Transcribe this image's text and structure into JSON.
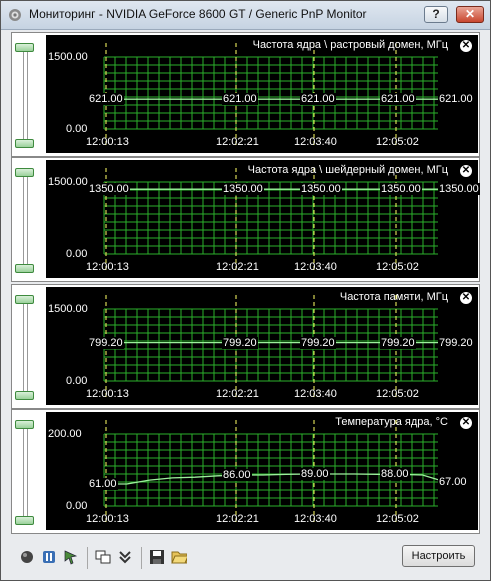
{
  "window": {
    "title": "Мониторинг - NVIDIA GeForce 8600 GT / Generic PnP Monitor",
    "help_label": "?",
    "close_label": "✕"
  },
  "panels": [
    {
      "title": "Частота ядра \\ растровый домен, МГц",
      "y_max": "1500.00",
      "y_min": "0.00",
      "times": [
        "12:00:13",
        "12:02:21",
        "12:03:40",
        "12:05:02"
      ],
      "values": [
        "621.00",
        "621.00",
        "621.00",
        "621.00",
        "621.00"
      ],
      "close_label": "✕"
    },
    {
      "title": "Частота ядра \\ шейдерный домен, МГц",
      "y_max": "1500.00",
      "y_min": "0.00",
      "times": [
        "12:00:13",
        "12:02:21",
        "12:03:40",
        "12:05:02"
      ],
      "values": [
        "1350.00",
        "1350.00",
        "1350.00",
        "1350.00",
        "1350.00"
      ],
      "close_label": "✕"
    },
    {
      "title": "Частота памяти, МГц",
      "y_max": "1500.00",
      "y_min": "0.00",
      "times": [
        "12:00:13",
        "12:02:21",
        "12:03:40",
        "12:05:02"
      ],
      "values": [
        "799.20",
        "799.20",
        "799.20",
        "799.20",
        "799.20"
      ],
      "close_label": "✕"
    },
    {
      "title": "Температура ядра, °C",
      "y_max": "200.00",
      "y_min": "0.00",
      "times": [
        "12:00:13",
        "12:02:21",
        "12:03:40",
        "12:05:02"
      ],
      "values": [
        "61.00",
        "86.00",
        "89.00",
        "88.00",
        "67.00"
      ],
      "close_label": "✕"
    }
  ],
  "chart_data": [
    {
      "type": "line",
      "title": "Частота ядра \\ растровый домен, МГц",
      "ylim": [
        0,
        1500
      ],
      "series": [
        {
          "values": [
            621,
            621,
            621,
            621,
            621,
            621,
            621,
            621,
            621,
            621
          ]
        }
      ]
    },
    {
      "type": "line",
      "title": "Частота ядра \\ шейдерный домен, МГц",
      "ylim": [
        0,
        1500
      ],
      "series": [
        {
          "values": [
            1350,
            1350,
            1350,
            1350,
            1350,
            1350,
            1350,
            1350,
            1350,
            1350
          ]
        }
      ]
    },
    {
      "type": "line",
      "title": "Частота памяти, МГц",
      "ylim": [
        0,
        1500
      ],
      "series": [
        {
          "values": [
            799.2,
            799.2,
            799.2,
            799.2,
            799.2,
            799.2,
            799.2,
            799.2,
            799.2,
            799.2
          ]
        }
      ]
    },
    {
      "type": "line",
      "title": "Температура ядра, °C",
      "ylim": [
        0,
        200
      ],
      "series": [
        {
          "values": [
            61,
            61,
            72,
            78,
            80,
            84,
            86,
            86,
            88,
            89,
            89,
            89,
            88,
            88,
            86,
            67,
            67
          ]
        }
      ]
    }
  ],
  "toolbar": {
    "settings_label": "Настроить",
    "icons": [
      "record-icon",
      "pause-icon",
      "cursor-icon",
      "windows-icon",
      "collapse-icon",
      "save-icon",
      "open-folder-icon"
    ]
  },
  "colors": {
    "grid": "#2bb02b",
    "line": "#9cf09c",
    "plot_bg": "#000000",
    "marker": "#ffff66"
  }
}
